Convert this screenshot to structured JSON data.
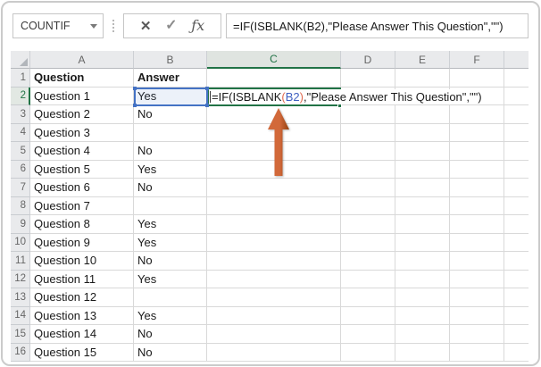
{
  "toolbar": {
    "name_box": "COUNTIF",
    "dropdown_icon": "▾",
    "cancel_icon": "✕",
    "enter_icon": "✓",
    "fx_icon": "ƒx",
    "formula": "=IF(ISBLANK(B2),\"Please Answer This Question\",\"\")"
  },
  "grid": {
    "columns": [
      "A",
      "B",
      "C",
      "D",
      "E",
      "F"
    ],
    "selected_column": "C",
    "selected_row": "2",
    "rows": [
      {
        "n": "1",
        "a": "Question",
        "b": "Answer",
        "bold": true
      },
      {
        "n": "2",
        "a": "Question 1",
        "b": "Yes"
      },
      {
        "n": "3",
        "a": "Question 2",
        "b": "No"
      },
      {
        "n": "4",
        "a": "Question 3",
        "b": ""
      },
      {
        "n": "5",
        "a": "Question 4",
        "b": "No"
      },
      {
        "n": "6",
        "a": "Question 5",
        "b": "Yes"
      },
      {
        "n": "7",
        "a": "Question 6",
        "b": "No"
      },
      {
        "n": "8",
        "a": "Question 7",
        "b": ""
      },
      {
        "n": "9",
        "a": "Question 8",
        "b": "Yes"
      },
      {
        "n": "10",
        "a": "Question 9",
        "b": "Yes"
      },
      {
        "n": "11",
        "a": "Question 10",
        "b": "No"
      },
      {
        "n": "12",
        "a": "Question 11",
        "b": "Yes"
      },
      {
        "n": "13",
        "a": "Question 12",
        "b": ""
      },
      {
        "n": "14",
        "a": "Question 13",
        "b": "Yes"
      },
      {
        "n": "15",
        "a": "Question 14",
        "b": "No"
      },
      {
        "n": "16",
        "a": "Question 15",
        "b": "No"
      }
    ]
  },
  "cell_edit": {
    "cell": "C2",
    "parts": [
      {
        "text": "=IF(ISBLANK",
        "color": "#1a1a1a"
      },
      {
        "text": "(",
        "color": "#e0694f"
      },
      {
        "text": "B2",
        "color": "#3f5fc0"
      },
      {
        "text": ")",
        "color": "#e0694f"
      },
      {
        "text": ",\"Please Answer This Question\",\"\")",
        "color": "#1a1a1a"
      }
    ]
  },
  "referenced_cell": {
    "cell": "B2",
    "value": "Yes"
  },
  "annotation": {
    "arrow_direction": "up",
    "points_to": "C2"
  },
  "colors": {
    "selection_green": "#217346",
    "reference_blue": "#4472c4",
    "arrow_light": "#d2693a",
    "arrow_dark": "#93400f"
  }
}
